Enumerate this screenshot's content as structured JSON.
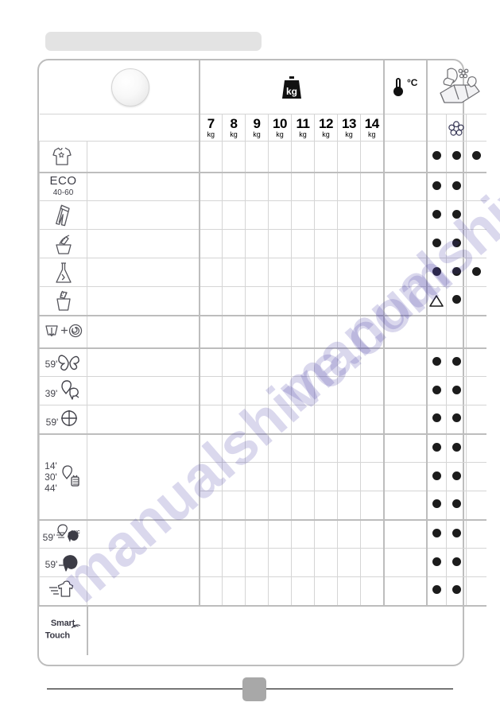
{
  "page": {
    "page_number": "",
    "top_bar": "",
    "watermark_text": "manualshive.com"
  },
  "table": {
    "header": {
      "program_col_label": "",
      "knob": "program-selector-knob",
      "load_icon_label": "kg",
      "temperature_label": "°C",
      "detergent_drawer_label": "detergent-drawer",
      "softener_label": "softener-flower",
      "capacity_columns": [
        {
          "num": "7",
          "unit": "kg"
        },
        {
          "num": "8",
          "unit": "kg"
        },
        {
          "num": "9",
          "unit": "kg"
        },
        {
          "num": "10",
          "unit": "kg"
        },
        {
          "num": "11",
          "unit": "kg"
        },
        {
          "num": "12",
          "unit": "kg"
        },
        {
          "num": "13",
          "unit": "kg"
        },
        {
          "num": "14",
          "unit": "kg"
        }
      ]
    },
    "rows": [
      {
        "id": "cotton-star",
        "icon": "shirt-star-icon",
        "label": "",
        "temperature": "",
        "marks": [
          "dot",
          "dot",
          "dot"
        ]
      },
      {
        "id": "eco-40-60",
        "icon": "eco-text",
        "label": "ECO",
        "sublabel": "40-60",
        "temperature": "",
        "marks": [
          "dot",
          "dot",
          ""
        ]
      },
      {
        "id": "jeans",
        "icon": "jeans-icon",
        "label": "",
        "temperature": "",
        "marks": [
          "dot",
          "dot",
          ""
        ]
      },
      {
        "id": "hand-wash",
        "icon": "hand-wash-icon",
        "label": "",
        "temperature": "",
        "marks": [
          "dot",
          "dot",
          ""
        ]
      },
      {
        "id": "chemical-care",
        "icon": "flask-icon",
        "label": "",
        "temperature": "",
        "marks": [
          "dot",
          "dot",
          "dot"
        ]
      },
      {
        "id": "anti-allergy",
        "icon": "steam-basket-icon",
        "label": "",
        "temperature": "",
        "marks": [
          "triangle",
          "dot",
          ""
        ]
      },
      {
        "id": "rinse-spin",
        "icon": "rinse-plus-spin-icon",
        "label": "",
        "temperature": "",
        "marks": [
          "",
          "",
          ""
        ]
      },
      {
        "id": "rapid-59-delicates",
        "icon": "butterfly-icon",
        "label": "59'",
        "temperature": "",
        "marks": [
          "dot",
          "dot",
          ""
        ]
      },
      {
        "id": "rapid-39-mix",
        "icon": "shirt-bird-icon",
        "label": "39'",
        "temperature": "",
        "marks": [
          "dot",
          "dot",
          ""
        ]
      },
      {
        "id": "rapid-59-hygiene",
        "icon": "cross-circle-icon",
        "label": "59'",
        "temperature": "",
        "marks": [
          "dot",
          "dot",
          ""
        ]
      },
      {
        "id": "rapid-14-30-44-a",
        "icon": "rapid-times-icon",
        "label": "14'",
        "temperature": "",
        "marks": [
          "dot",
          "dot",
          ""
        ]
      },
      {
        "id": "rapid-14-30-44-b",
        "icon": "",
        "label": "30'",
        "temperature": "",
        "marks": [
          "dot",
          "dot",
          ""
        ]
      },
      {
        "id": "rapid-14-30-44-c",
        "icon": "",
        "label": "44'",
        "temperature": "",
        "marks": [
          "dot",
          "dot",
          ""
        ]
      },
      {
        "id": "cold-wash-59",
        "icon": "cold-wash-20c-icon",
        "label": "59'",
        "temperature": "20°C",
        "marks": [
          "dot",
          "dot",
          ""
        ]
      },
      {
        "id": "delicates-59",
        "icon": "sweater-icon",
        "label": "59'",
        "temperature": "",
        "marks": [
          "dot",
          "dot",
          ""
        ]
      },
      {
        "id": "refresh-air",
        "icon": "steam-refresh-icon",
        "label": "",
        "temperature": "",
        "marks": [
          "dot",
          "dot",
          ""
        ]
      }
    ],
    "footer_row": {
      "id": "smart-touch",
      "label": "Smart Touch",
      "icon": "wifi-waves-icon"
    }
  }
}
